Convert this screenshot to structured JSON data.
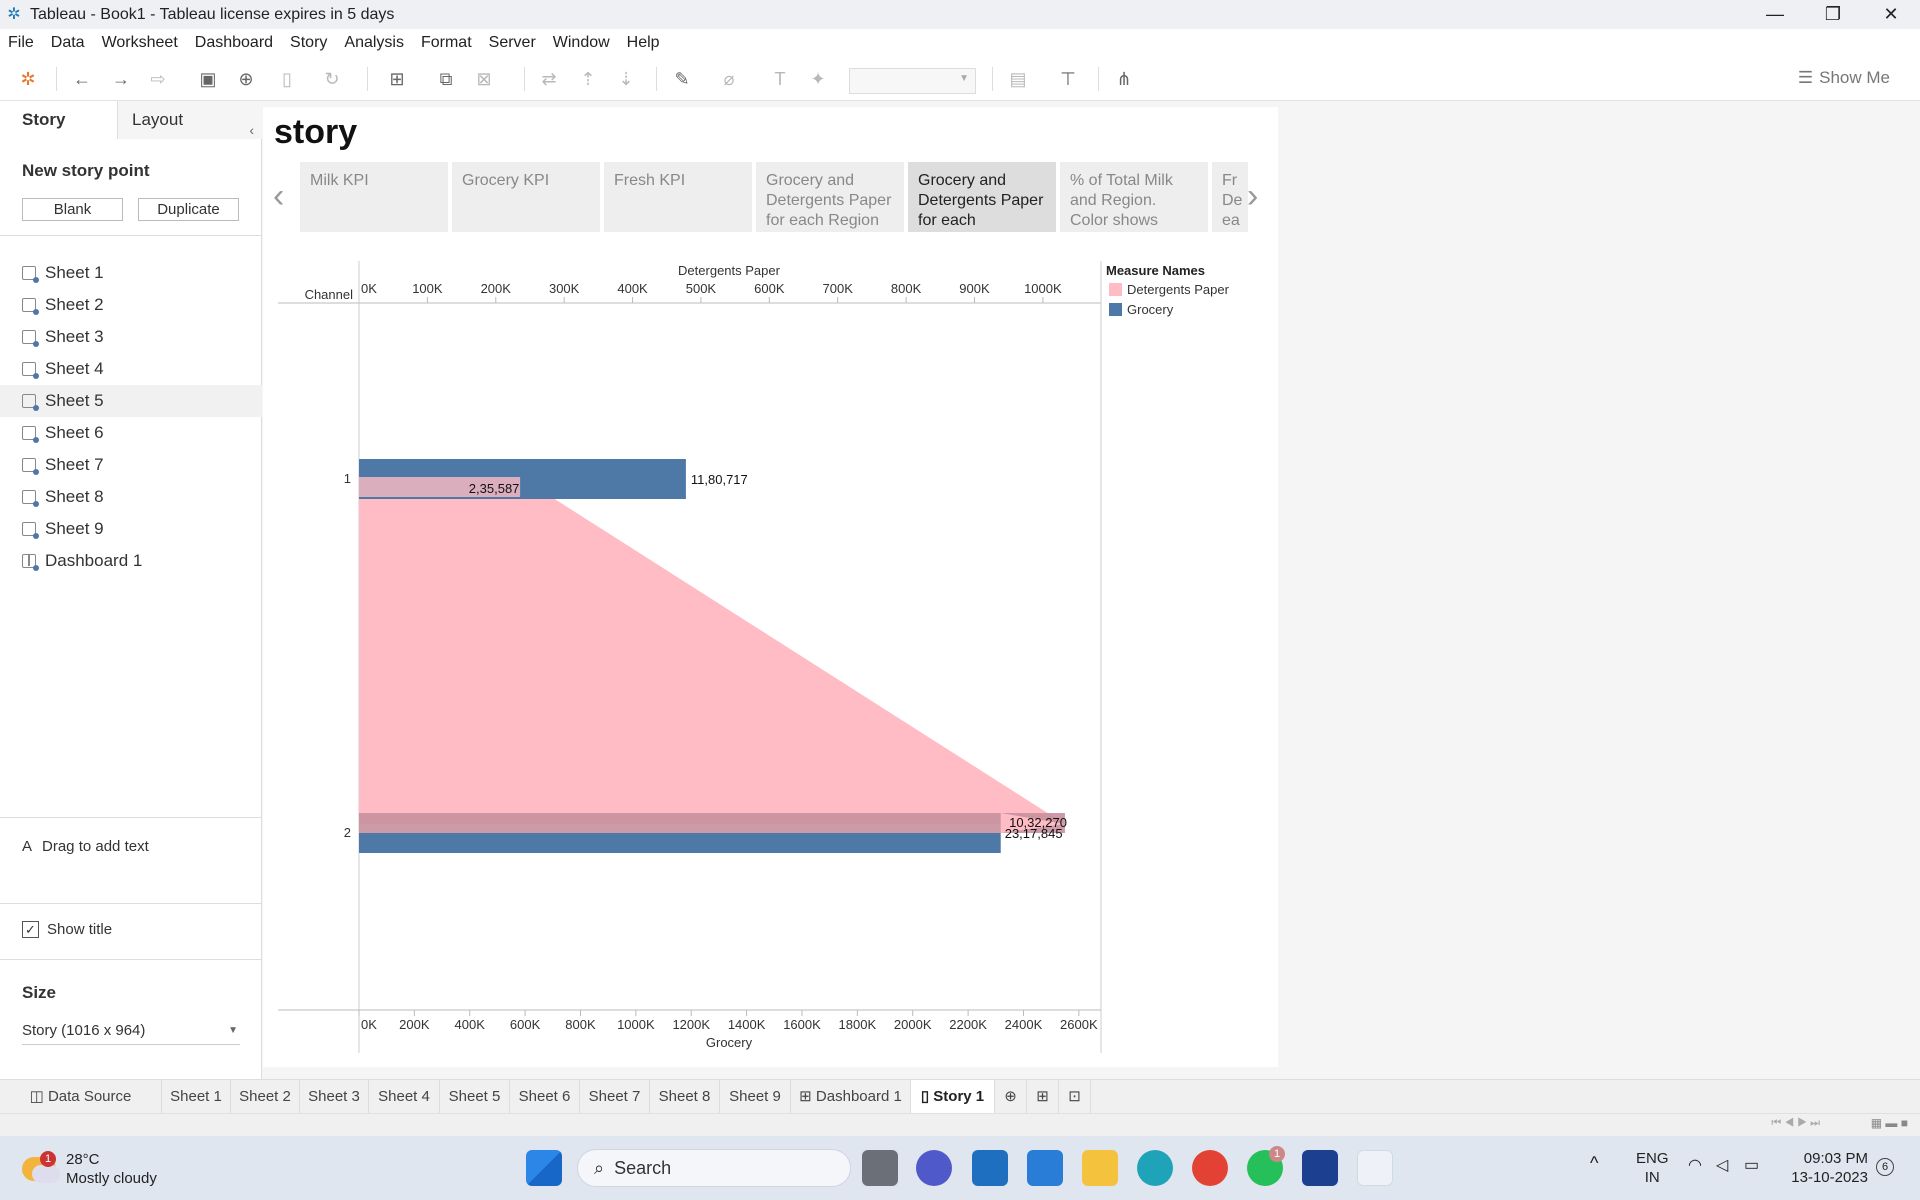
{
  "window": {
    "title": "Tableau - Book1 - Tableau license expires in 5 days",
    "minimize_icon": "—",
    "restore_icon": "❐",
    "close_icon": "✕"
  },
  "menu": [
    "File",
    "Data",
    "Worksheet",
    "Dashboard",
    "Story",
    "Analysis",
    "Format",
    "Server",
    "Window",
    "Help"
  ],
  "toolbar": {
    "show_me": "Show Me"
  },
  "sidebar": {
    "tab_story": "Story",
    "tab_layout": "Layout",
    "new_story_point": "New story point",
    "blank_button": "Blank",
    "duplicate_button": "Duplicate",
    "sheets": [
      "Sheet 1",
      "Sheet 2",
      "Sheet 3",
      "Sheet 4",
      "Sheet 5",
      "Sheet 6",
      "Sheet 7",
      "Sheet 8",
      "Sheet 9",
      "Dashboard 1"
    ],
    "drag_text": "Drag to add text",
    "show_title": "Show title",
    "size_label": "Size",
    "size_value": "Story (1016 x 964)"
  },
  "story": {
    "title": "story",
    "points": [
      "Milk KPI",
      "Grocery KPI",
      "Fresh KPI",
      "Grocery and Detergents Paper for each Region",
      "Grocery and Detergents Paper for each",
      "% of Total Milk and Region. Color shows",
      "Fr De ea"
    ],
    "active_index": 4
  },
  "chart_data": {
    "type": "bar",
    "row_header": "Channel",
    "categories": [
      "1",
      "2"
    ],
    "top_axis": {
      "label": "Detergents Paper",
      "ticks": [
        "0K",
        "100K",
        "200K",
        "300K",
        "400K",
        "500K",
        "600K",
        "700K",
        "800K",
        "900K",
        "1000K"
      ],
      "range": [
        0,
        1085000
      ]
    },
    "bottom_axis": {
      "label": "Grocery",
      "ticks": [
        "0K",
        "200K",
        "400K",
        "600K",
        "800K",
        "1000K",
        "1200K",
        "1400K",
        "1600K",
        "1800K",
        "2000K",
        "2200K",
        "2400K",
        "2600K"
      ],
      "range": [
        0,
        2680000
      ]
    },
    "series": [
      {
        "name": "Detergents Paper",
        "color": "#ffbcc4",
        "values": [
          235587,
          1032270
        ],
        "labels": [
          "2,35,587",
          "10,32,270"
        ]
      },
      {
        "name": "Grocery",
        "color": "#4e79a7",
        "values": [
          1180717,
          2317845
        ],
        "labels": [
          "11,80,717",
          "23,17,845"
        ]
      }
    ],
    "legend": {
      "title": "Measure Names",
      "position": "right"
    }
  },
  "bottom_tabs": [
    "Data Source",
    "Sheet 1",
    "Sheet 2",
    "Sheet 3",
    "Sheet 4",
    "Sheet 5",
    "Sheet 6",
    "Sheet 7",
    "Sheet 8",
    "Sheet 9",
    "Dashboard 1",
    "Story 1"
  ],
  "taskbar": {
    "temp": "28°C",
    "weather": "Mostly cloudy",
    "weather_badge": "1",
    "search": "Search",
    "lang": "ENG",
    "region": "IN",
    "time": "09:03 PM",
    "date": "13-10-2023",
    "notif_count": "6",
    "whatsapp_badge": "1"
  }
}
